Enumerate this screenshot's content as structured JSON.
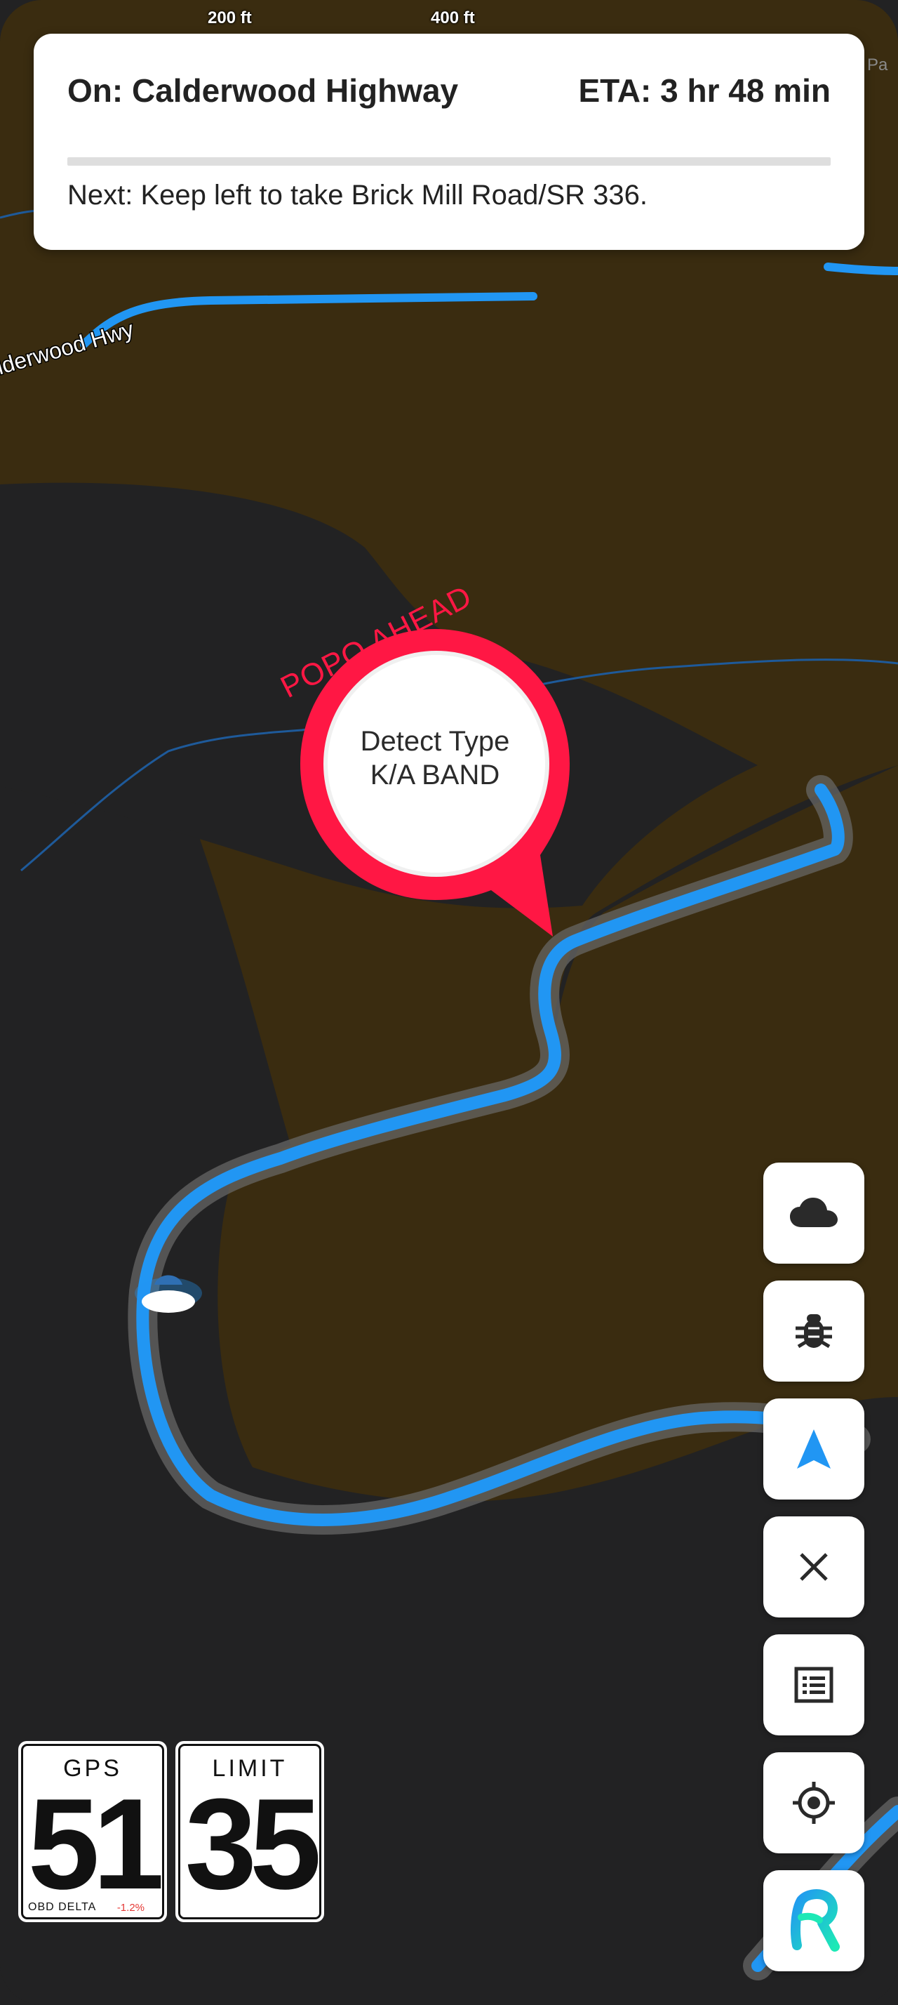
{
  "map": {
    "scale_labels": [
      "200 ft",
      "400 ft"
    ],
    "road_label": "Calderwood Hwy",
    "corner_label": "Pa"
  },
  "navigation": {
    "current_road": "On: Calderwood Highway",
    "eta": "ETA: 3 hr 48 min",
    "next_instruction": "Next: Keep left to take Brick Mill Road/SR 336.",
    "progress_fraction": 0
  },
  "alert_marker": {
    "heading": "POPO AHEAD",
    "line1": "Detect Type",
    "line2": "K/A BAND",
    "color": "#ff1744"
  },
  "controls": [
    {
      "name": "weather-button",
      "icon": "cloud-icon"
    },
    {
      "name": "debug-button",
      "icon": "bug-icon"
    },
    {
      "name": "navigate-button",
      "icon": "navigation-arrow-icon"
    },
    {
      "name": "close-button",
      "icon": "close-icon"
    },
    {
      "name": "list-button",
      "icon": "list-icon"
    },
    {
      "name": "recenter-button",
      "icon": "crosshair-icon"
    },
    {
      "name": "app-logo-button",
      "icon": "app-logo-icon"
    }
  ],
  "speed": {
    "gps_label": "GPS",
    "gps_value": "51",
    "obd_label": "OBD DELTA",
    "obd_delta": "-1.2%",
    "limit_label": "LIMIT",
    "limit_value": "35"
  },
  "colors": {
    "route": "#2196f3",
    "terrain": "#3a2c10",
    "background": "#222223",
    "alert": "#ff1744"
  }
}
